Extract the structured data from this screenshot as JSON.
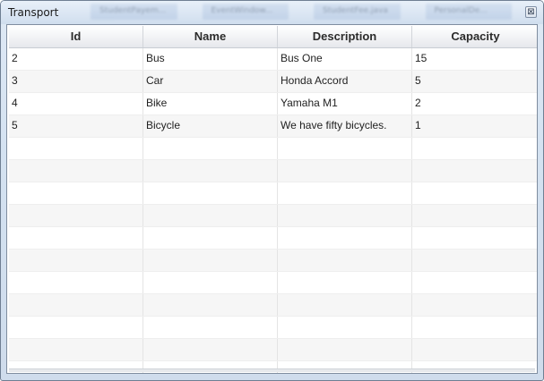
{
  "window": {
    "title": "Transport",
    "close_glyph": "⊠",
    "background_tabs": [
      "StudentPayem...",
      "EventWindow...",
      "StudentFee.java",
      "PersonalDe..."
    ]
  },
  "table": {
    "columns": [
      "Id",
      "Name",
      "Description",
      "Capacity"
    ],
    "rows": [
      [
        "2",
        "Bus",
        "Bus One",
        "15"
      ],
      [
        "3",
        "Car",
        "Honda Accord",
        "5"
      ],
      [
        "4",
        "Bike",
        "Yamaha M1",
        "2"
      ],
      [
        "5",
        "Bicycle",
        "We have fifty bicycles.",
        "1"
      ]
    ],
    "empty_row_count": 11
  }
}
